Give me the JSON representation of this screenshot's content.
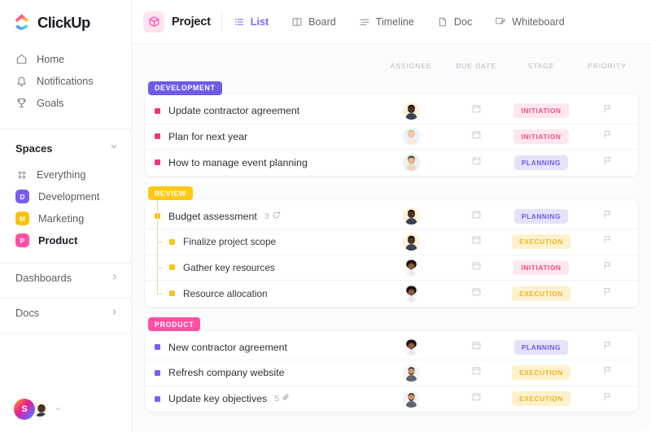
{
  "brand": {
    "name": "ClickUp",
    "accent": "#7b68ee",
    "logo_icon": "clickup-logo-icon"
  },
  "sidebar": {
    "nav": [
      {
        "label": "Home",
        "icon": "home-icon"
      },
      {
        "label": "Notifications",
        "icon": "bell-icon"
      },
      {
        "label": "Goals",
        "icon": "trophy-icon"
      }
    ],
    "spaces": {
      "title": "Spaces",
      "chevron": "chevron-down-icon",
      "everything": {
        "label": "Everything",
        "icon": "grid-dots-icon"
      },
      "items": [
        {
          "label": "Development",
          "initial": "D",
          "color": "#7b5cf0",
          "active": false
        },
        {
          "label": "Marketing",
          "initial": "M",
          "color": "#ffc107",
          "active": false
        },
        {
          "label": "Product",
          "initial": "P",
          "color": "#ff4fa3",
          "active": true
        }
      ]
    },
    "bottom": [
      {
        "label": "Dashboards",
        "chevron": "chevron-right-icon"
      },
      {
        "label": "Docs",
        "chevron": "chevron-right-icon"
      }
    ],
    "footer": {
      "workspace_initial": "S",
      "avatar": "user-avatar",
      "chevron": "chevron-down-icon"
    }
  },
  "topbar": {
    "project": {
      "label": "Project",
      "icon": "cube-icon"
    },
    "tabs": [
      {
        "label": "List",
        "icon": "list-icon",
        "active": true
      },
      {
        "label": "Board",
        "icon": "board-icon",
        "active": false
      },
      {
        "label": "Timeline",
        "icon": "timeline-icon",
        "active": false
      },
      {
        "label": "Doc",
        "icon": "doc-icon",
        "active": false
      },
      {
        "label": "Whiteboard",
        "icon": "whiteboard-icon",
        "active": false
      }
    ]
  },
  "table": {
    "columns": [
      "ASSIGNEE",
      "DUE DATE",
      "STAGE",
      "PRIORITY"
    ],
    "groups": [
      {
        "name": "DEVELOPMENT",
        "tag_color": "#6c5ce7",
        "bullet_color": "#f0347e",
        "rows": [
          {
            "title": "Update contractor agreement",
            "stage": "INITIATION",
            "stage_style": "initiation",
            "avatar": "avatar-male-1",
            "due_icon": "calendar-icon",
            "priority_icon": "flag-icon",
            "sub": false
          },
          {
            "title": "Plan for next year",
            "stage": "INITIATION",
            "stage_style": "initiation",
            "avatar": "avatar-female-1",
            "due_icon": "calendar-icon",
            "priority_icon": "flag-icon",
            "sub": false
          },
          {
            "title": "How to manage event planning",
            "stage": "PLANNING",
            "stage_style": "planning",
            "avatar": "avatar-female-2",
            "due_icon": "calendar-icon",
            "priority_icon": "flag-icon",
            "sub": false
          }
        ]
      },
      {
        "name": "REVIEW",
        "tag_color": "#ffc816",
        "bullet_color": "#f5c518",
        "rows": [
          {
            "title": "Budget assessment",
            "meta_count": "3",
            "meta_icon": "subtasks-refresh-icon",
            "stage": "PLANNING",
            "stage_style": "planning",
            "avatar": "avatar-male-1",
            "due_icon": "calendar-icon",
            "priority_icon": "flag-icon",
            "sub": false
          },
          {
            "title": "Finalize project scope",
            "stage": "EXECUTION",
            "stage_style": "execution",
            "avatar": "avatar-male-1",
            "due_icon": "calendar-icon",
            "priority_icon": "flag-icon",
            "sub": true
          },
          {
            "title": "Gather key resources",
            "stage": "INITIATION",
            "stage_style": "initiation",
            "avatar": "avatar-afro",
            "due_icon": "calendar-icon",
            "priority_icon": "flag-icon",
            "sub": true
          },
          {
            "title": "Resource allocation",
            "stage": "EXECUTION",
            "stage_style": "execution",
            "avatar": "avatar-afro",
            "due_icon": "calendar-icon",
            "priority_icon": "flag-icon",
            "sub": true
          }
        ]
      },
      {
        "name": "PRODUCT",
        "tag_color": "#ff4fa3",
        "bullet_color": "#7b5cf0",
        "rows": [
          {
            "title": "New contractor agreement",
            "stage": "PLANNING",
            "stage_style": "planning",
            "avatar": "avatar-afro",
            "due_icon": "calendar-icon",
            "priority_icon": "flag-icon",
            "sub": false
          },
          {
            "title": "Refresh company website",
            "stage": "EXECUTION",
            "stage_style": "execution",
            "avatar": "avatar-male-2",
            "due_icon": "calendar-icon",
            "priority_icon": "flag-icon",
            "sub": false
          },
          {
            "title": "Update key objectives",
            "meta_count": "5",
            "meta_icon": "attachment-icon",
            "stage": "EXECUTION",
            "stage_style": "execution",
            "avatar": "avatar-male-2",
            "due_icon": "calendar-icon",
            "priority_icon": "flag-icon",
            "sub": false
          }
        ]
      }
    ]
  }
}
